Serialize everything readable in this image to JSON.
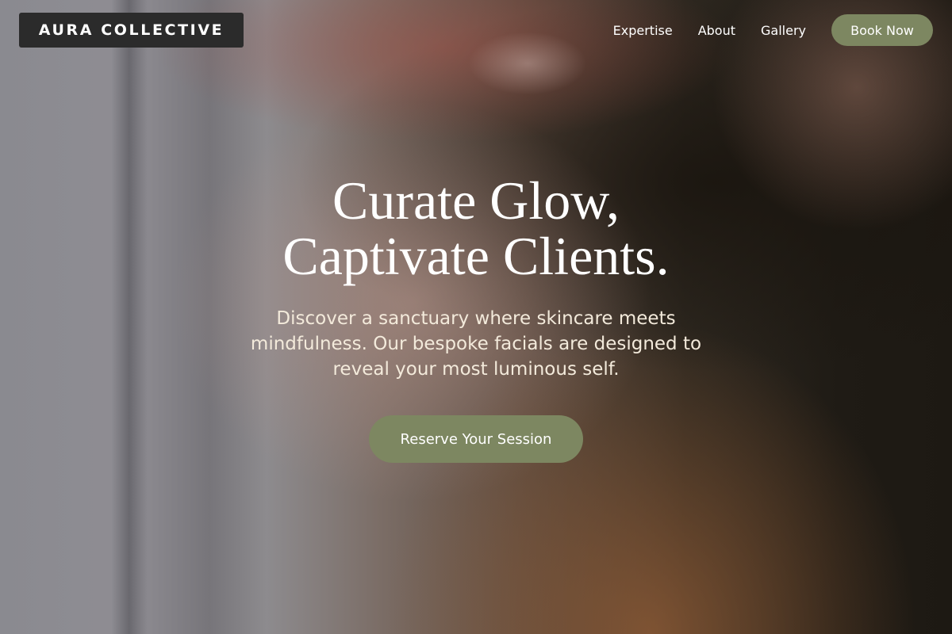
{
  "brand": {
    "name": "AURA COLLECTIVE"
  },
  "nav": {
    "links": [
      {
        "label": "Expertise"
      },
      {
        "label": "About"
      },
      {
        "label": "Gallery"
      }
    ],
    "cta_label": "Book Now"
  },
  "hero": {
    "headline_line1": "Curate Glow,",
    "headline_line2": "Captivate Clients.",
    "subtitle": "Discover a sanctuary where skincare meets mindfulness. Our bespoke facials are designed to reveal your most luminous self.",
    "cta_label": "Reserve Your Session",
    "background_image": "close-up-lips-photo"
  },
  "colors": {
    "accent": "#7d8761",
    "brand_bg": "#2b2b2b",
    "headline": "#ffffff",
    "subtitle": "#f3eadb"
  }
}
